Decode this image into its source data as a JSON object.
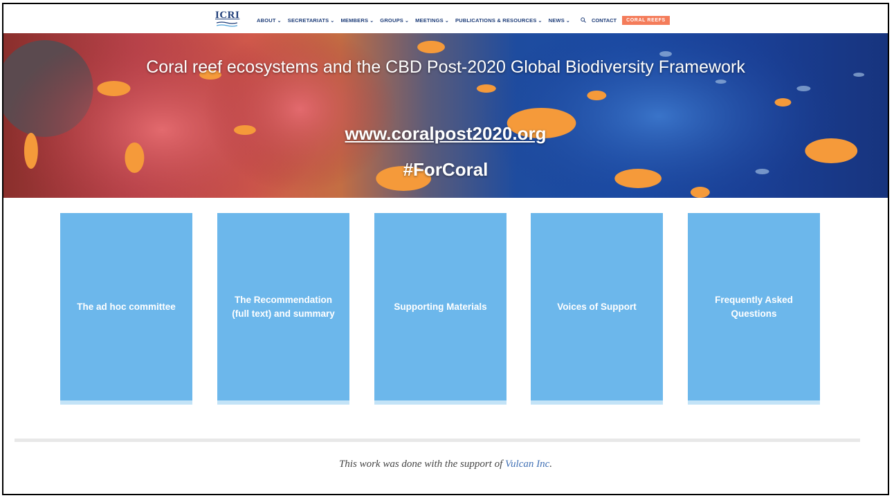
{
  "nav": {
    "logo": "ICRI",
    "items": [
      {
        "label": "ABOUT"
      },
      {
        "label": "SECRETARIATS"
      },
      {
        "label": "MEMBERS"
      },
      {
        "label": "GROUPS"
      },
      {
        "label": "MEETINGS"
      },
      {
        "label": "PUBLICATIONS & RESOURCES"
      },
      {
        "label": "NEWS"
      }
    ],
    "search_icon": "search-icon",
    "contact": "CONTACT",
    "coral_button": "CORAL REEFS"
  },
  "hero": {
    "title": "Coral reef ecosystems and the CBD Post-2020 Global Biodiversity Framework",
    "link": "www.coralpost2020.org",
    "tag": "#ForCoral"
  },
  "cards": [
    {
      "label": "The ad hoc committee"
    },
    {
      "label": "The Recommendation (full text) and summary"
    },
    {
      "label": "Supporting Materials"
    },
    {
      "label": "Voices of Support"
    },
    {
      "label": "Frequently Asked Questions"
    }
  ],
  "footer": {
    "text": "This work was done with the support of ",
    "link": "Vulcan Inc",
    "suffix": "."
  },
  "colors": {
    "brand": "#1d3c78",
    "accent": "#f47c5a",
    "card": "#6cb7eb"
  }
}
